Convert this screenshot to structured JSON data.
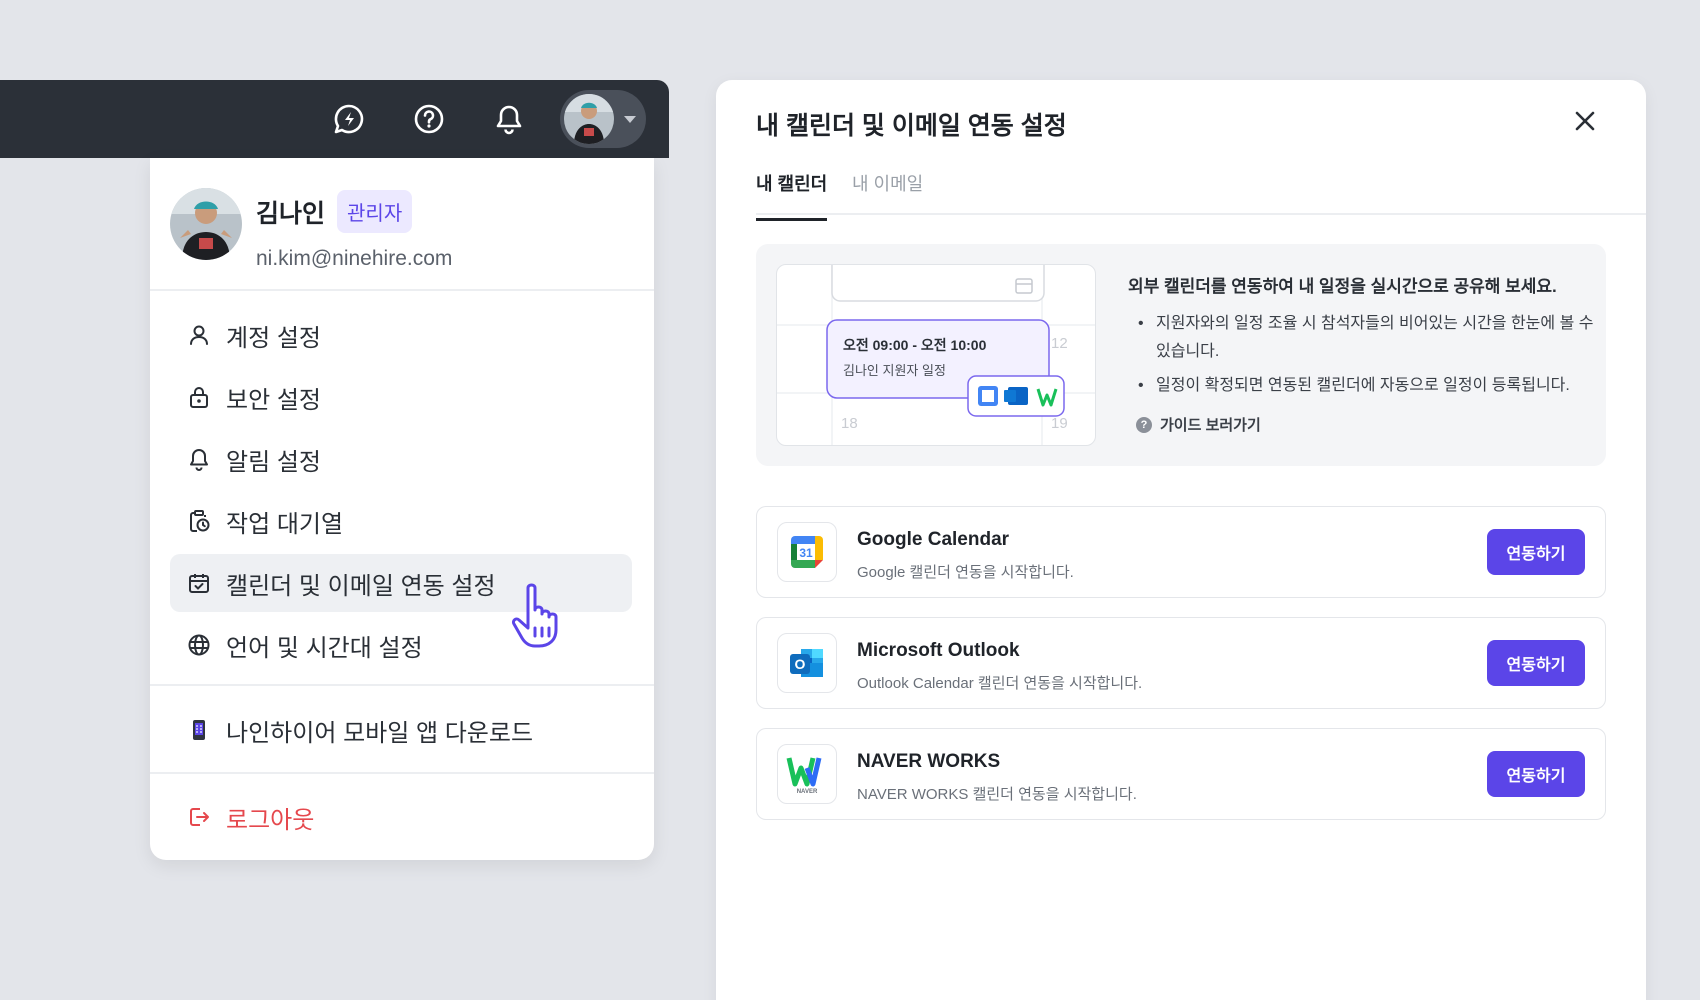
{
  "menu": {
    "profile": {
      "name": "김나인",
      "role_badge": "관리자",
      "email": "ni.kim@ninehire.com"
    },
    "items": [
      {
        "label": "계정 설정",
        "icon": "user-icon"
      },
      {
        "label": "보안 설정",
        "icon": "lock-icon"
      },
      {
        "label": "알림 설정",
        "icon": "bell-icon"
      },
      {
        "label": "작업 대기열",
        "icon": "clipboard-clock-icon"
      },
      {
        "label": "캘린더 및 이메일 연동 설정",
        "icon": "calendar-check-icon"
      },
      {
        "label": "언어 및 시간대 설정",
        "icon": "globe-icon"
      }
    ],
    "mobile_app": {
      "label": "나인하이어 모바일 앱 다운로드",
      "icon": "phone-icon"
    },
    "logout": {
      "label": "로그아웃",
      "icon": "logout-icon"
    }
  },
  "panel": {
    "title": "내 캘린더 및 이메일 연동 설정",
    "tabs": [
      {
        "label": "내 캘린더",
        "active": true
      },
      {
        "label": "내 이메일",
        "active": false
      }
    ],
    "info": {
      "title": "외부 캘린더를 연동하여 내 일정을 실시간으로 공유해 보세요.",
      "bullets": [
        "지원자와의 일정 조율 시 참석자들의 비어있는 시간을 한눈에 볼 수 있습니다.",
        "일정이 확정되면 연동된 캘린더에 자동으로 일정이 등록됩니다."
      ],
      "guide_link": "가이드 보러가기",
      "illustration": {
        "event_time": "오전 09:00 - 오전 10:00",
        "event_name": "김나인 지원자 일정",
        "day_labels": [
          "12",
          "18",
          "19"
        ]
      }
    },
    "services": [
      {
        "name": "Google Calendar",
        "desc": "Google 캘린더 연동을 시작합니다.",
        "button": "연동하기",
        "logo_text": "31"
      },
      {
        "name": "Microsoft Outlook",
        "desc": "Outlook Calendar 캘린더 연동을 시작합니다.",
        "button": "연동하기",
        "logo_text": "O"
      },
      {
        "name": "NAVER WORKS",
        "desc": "NAVER WORKS 캘린더 연동을 시작합니다.",
        "button": "연동하기",
        "logo_text": "NAVER"
      }
    ]
  },
  "colors": {
    "accent": "#5b45e8",
    "topbar": "#2b3038",
    "logout": "#e5484d",
    "badge_bg": "#ece9ff"
  }
}
